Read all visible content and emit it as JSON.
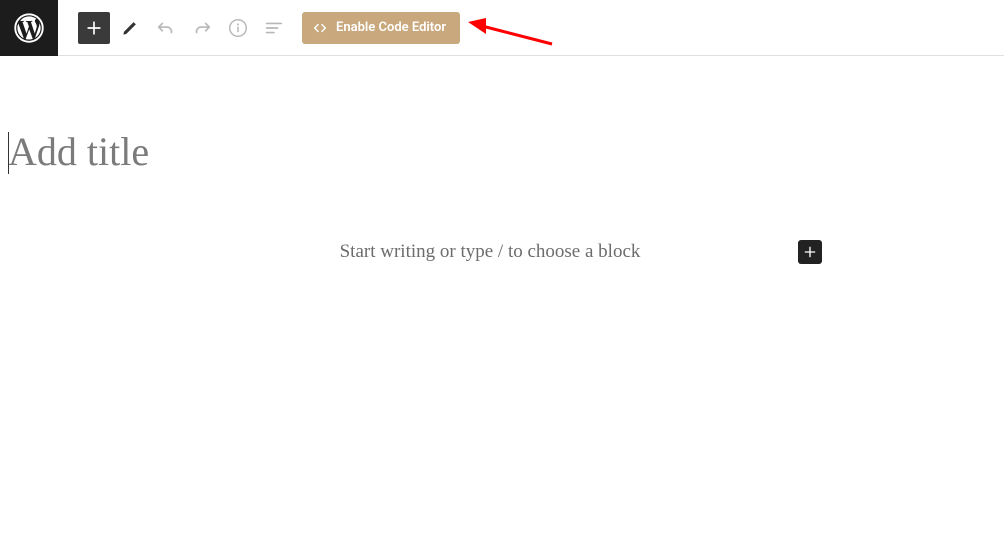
{
  "toolbar": {
    "enable_code_editor_label": "Enable Code Editor"
  },
  "editor": {
    "title_placeholder": "Add title",
    "block_placeholder": "Start writing or type / to choose a block"
  },
  "icons": {
    "wp_logo": "wordpress-logo-icon",
    "add": "plus-icon",
    "edit": "pencil-icon",
    "undo": "undo-icon",
    "redo": "redo-icon",
    "info": "info-icon",
    "outline": "list-view-icon",
    "code": "code-icon"
  }
}
